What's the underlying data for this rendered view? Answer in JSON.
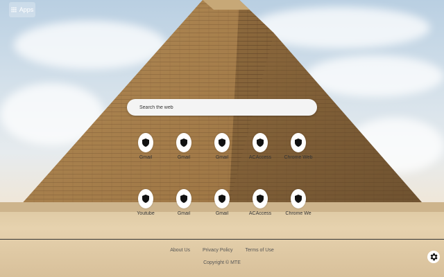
{
  "header": {
    "apps_label": "Apps"
  },
  "search": {
    "placeholder": "Search the web"
  },
  "shortcuts_row1": [
    {
      "label": "Gmail",
      "icon": "shield-icon"
    },
    {
      "label": "Gmail",
      "icon": "shield-icon"
    },
    {
      "label": "Gmail",
      "icon": "shield-icon"
    },
    {
      "label": "ACAccess",
      "icon": "shield-icon"
    },
    {
      "label": "Chrome Web",
      "icon": "shield-icon"
    }
  ],
  "shortcuts_row2": [
    {
      "label": "Youtube",
      "icon": "shield-icon"
    },
    {
      "label": "Gmail",
      "icon": "shield-icon"
    },
    {
      "label": "Gmail",
      "icon": "shield-icon"
    },
    {
      "label": "ACAccess",
      "icon": "shield-icon"
    },
    {
      "label": "Chrome We",
      "icon": "shield-icon"
    }
  ],
  "footer": {
    "about": "About Us",
    "privacy": "Privacy Policy",
    "terms": "Terms of Use",
    "copyright": "Copyright © MTE"
  },
  "colors": {
    "accent": "#ffffff",
    "text": "#333333"
  }
}
